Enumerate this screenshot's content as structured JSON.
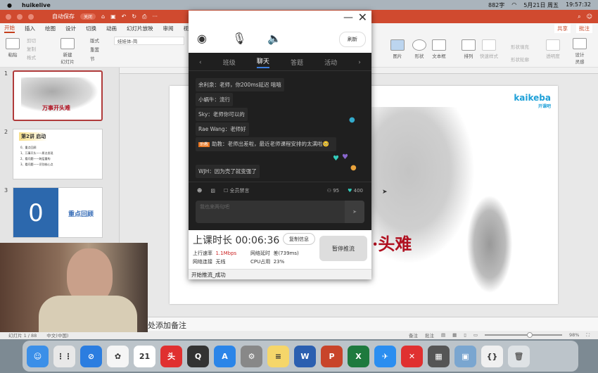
{
  "menubar": {
    "app": "huikelive",
    "status": [
      "882字",
      "5月21日 周五",
      "19:57:32"
    ]
  },
  "ppt": {
    "titlebar": {
      "autosave": "自动保存",
      "toggle": "关闭"
    },
    "tabs": [
      "开始",
      "插入",
      "绘图",
      "设计",
      "切换",
      "动画",
      "幻灯片放映",
      "审阅",
      "视"
    ],
    "share": "共享",
    "comment": "批注",
    "ribbon": {
      "paste": "粘贴",
      "cut": "剪切",
      "copy": "复制",
      "format": "格式",
      "new_slide": "新建\n幻灯片",
      "layout": "版式",
      "reset": "重置",
      "section": "节",
      "font": "娃娃体-简",
      "picture": "图片",
      "shape": "形状",
      "textbox": "文本框",
      "arrange": "排列",
      "quick_style": "快速样式",
      "shape_fill": "形状填充",
      "shape_outline": "形状轮廓",
      "transparency": "透明度",
      "design_ideas": "设计\n灵感"
    },
    "thumbnails": [
      {
        "num": "1",
        "title": "万事开头难"
      },
      {
        "num": "2",
        "title": "第2讲 启动",
        "lines": [
          "0、重点回顾",
          "1、万事开头——原点发现",
          "2、看问题——跨层重构",
          "3、看问题——识别核心点"
        ]
      },
      {
        "num": "3",
        "big": "0",
        "title": "重点回顾"
      }
    ],
    "slide": {
      "logo": "kaikeba",
      "logo_sub": "开课吧",
      "title_visible": "头难",
      "title_prefix": "·"
    },
    "notes": "处添加备注",
    "status": {
      "slide": "幻灯片 1 / 88",
      "lang": "中文(中国)",
      "notes": "备注",
      "comments": "批注",
      "zoom": "98%"
    }
  },
  "live": {
    "refresh": "刷新",
    "tabs": [
      {
        "label": "班级"
      },
      {
        "label": "聊天",
        "active": true
      },
      {
        "label": "答题"
      },
      {
        "label": "活动"
      }
    ],
    "messages": [
      {
        "user": "余利泉",
        "text": "老师，你200ms延迟 嘻嘻"
      },
      {
        "user": "小蜗牛",
        "text": "流行"
      },
      {
        "user": "Sky",
        "text": "老师你可以的"
      },
      {
        "user": "Rae Wang",
        "text": "老师好"
      },
      {
        "badge": "助教",
        "user": "助教",
        "text": "老师出差啦，最近老师课程安排的太满啦🥺"
      },
      {
        "user": "WJH",
        "text": "因为壳了就变强了"
      }
    ],
    "mute_all": "全员禁言",
    "viewers": "95",
    "likes": "400",
    "input_placeholder": "我也来两句吧",
    "duration_label": "上课时长",
    "duration": "00:06:36",
    "copy_info": "复制信息",
    "pause": "暂停推流",
    "upload_label": "上行速率",
    "upload": "1.1Mbps",
    "latency_label": "网络延时",
    "latency": "差(739ms)",
    "network_label": "网络连接",
    "network": "无线",
    "cpu_label": "CPU占用",
    "cpu": "23%",
    "status": "开始推流_成功"
  },
  "dock": [
    "Finder",
    "Launchpad",
    "Safari",
    "照片",
    "日历 21",
    "头条",
    "QuickTime",
    "App Store",
    "系统偏好设置",
    "备忘录",
    "Word",
    "PowerPoint",
    "Excel",
    "钉钉",
    "XMind",
    "计算器",
    "预览",
    "huikelive"
  ],
  "colors": {
    "ppt_accent": "#d04a2f",
    "live_bg": "#1f1f1f",
    "tab_active": "#3b7ddd",
    "slide_title": "#b01020",
    "logo": "#1ea0d8"
  }
}
